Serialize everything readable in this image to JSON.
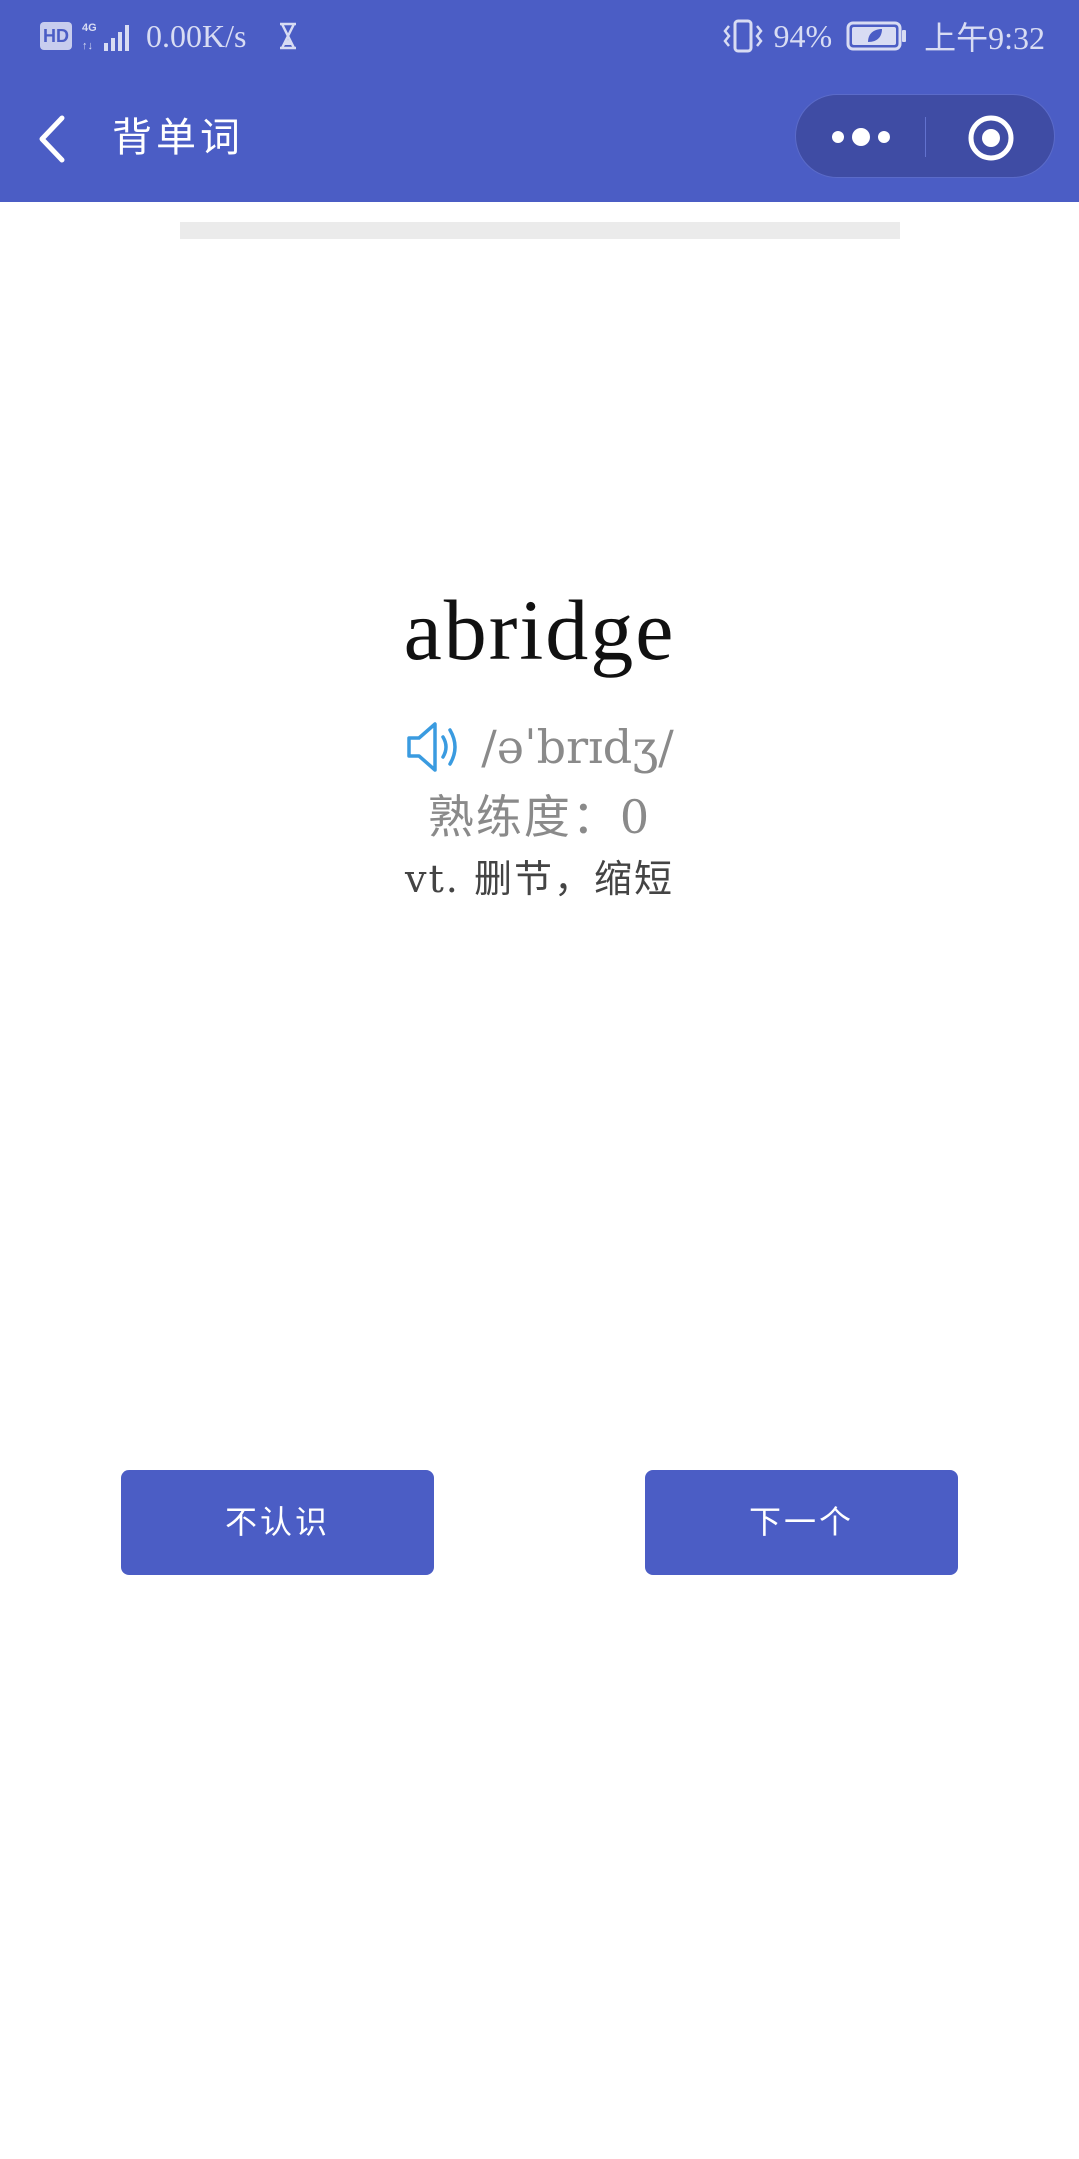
{
  "status_bar": {
    "hd_badge": "HD",
    "network_speed": "0.00K/s",
    "battery_percent": "94%",
    "time": "上午9:32",
    "icons": [
      "signal-4g-icon",
      "hourglass-icon",
      "vibrate-icon",
      "battery-icon"
    ]
  },
  "nav": {
    "title": "背单词",
    "icons": [
      "back-icon",
      "more-icon",
      "target-icon"
    ]
  },
  "progress": {
    "value": 0
  },
  "card": {
    "word": "abridge",
    "phonetic": "/əˈbrɪdʒ/",
    "proficiency": "熟练度：0",
    "meaning": "vt. 删节，缩短",
    "speaker_icon": "speaker-icon"
  },
  "actions": {
    "unknown_label": "不认识",
    "next_label": "下一个"
  },
  "colors": {
    "primary": "#4b5dc5",
    "speaker": "#3a9be0",
    "muted_text": "#8a8a8a"
  }
}
